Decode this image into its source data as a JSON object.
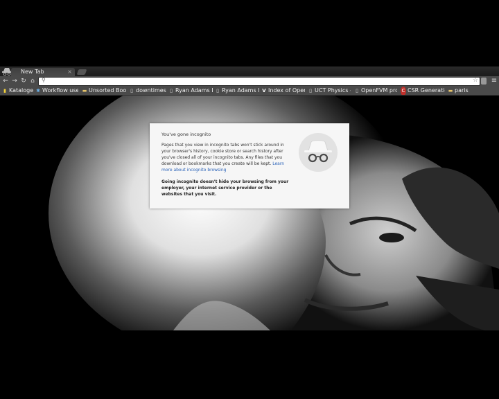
{
  "tabs": [
    {
      "title": "New Tab",
      "close": "×"
    }
  ],
  "toolbar": {
    "back": "←",
    "forward": "→",
    "reload": "↻",
    "home": "⌂",
    "omnibox": {
      "value": "",
      "search_glyph": "⚲"
    },
    "star": "☆",
    "menu": "≡"
  },
  "bookmarks": [
    {
      "label": "Kataloge",
      "icon": "bookmark-bars-icon",
      "glyph": "▮"
    },
    {
      "label": "Workflow use",
      "icon": "workflow-icon",
      "glyph": "✱"
    },
    {
      "label": "Unsorted Boo",
      "icon": "folder-icon",
      "glyph": "▬"
    },
    {
      "label": "downtimes",
      "icon": "page-icon",
      "glyph": "▯"
    },
    {
      "label": "Ryan Adams Li",
      "icon": "page-icon",
      "glyph": "▯"
    },
    {
      "label": "Ryan Adams Li",
      "icon": "page-icon",
      "glyph": "▯"
    },
    {
      "label": "Index of Open",
      "icon": "v-icon",
      "glyph": "V"
    },
    {
      "label": "UCT Physics -",
      "icon": "page-icon",
      "glyph": "▯"
    },
    {
      "label": "OpenFVM pro",
      "icon": "page-icon",
      "glyph": "▯"
    },
    {
      "label": "CSR Generatio",
      "icon": "c-icon",
      "glyph": "C"
    },
    {
      "label": "paris",
      "icon": "folder-icon",
      "glyph": "▬"
    }
  ],
  "incognito": {
    "title": "You've gone incognito",
    "p1": "Pages that you view in incognito tabs won't stick around in your browser's history, cookie store or search history after you've closed all of your incognito tabs. Any files that you download or bookmarks that you create will be kept.",
    "learn_more": "Learn more about incognito browsing",
    "p2": "Going incognito doesn't hide your browsing from your employer, your internet service provider or the websites that you visit."
  },
  "colors": {
    "link": "#2a62b8",
    "card": "#f6f6f6",
    "chrome_frame": "#4a4a4a"
  }
}
